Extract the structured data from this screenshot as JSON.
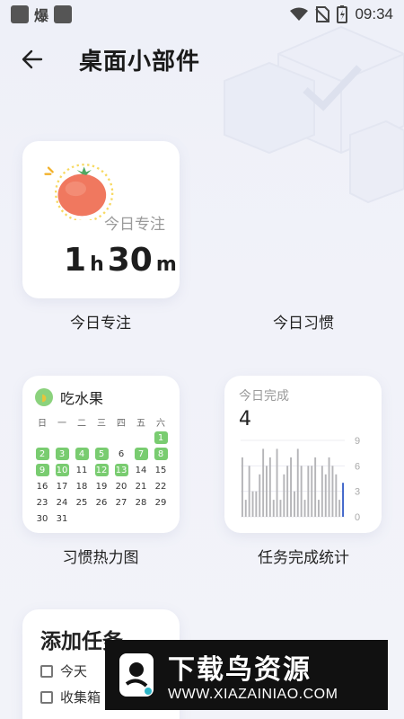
{
  "status_bar": {
    "time": "09:34",
    "app_icon_text": "爆"
  },
  "header": {
    "title": "桌面小部件"
  },
  "widgets": {
    "focus": {
      "label": "今日专注",
      "hours": "1",
      "hours_unit": "h",
      "minutes": "30",
      "minutes_unit": "m",
      "caption": "今日专注"
    },
    "habit": {
      "caption": "今日习惯"
    },
    "heatmap": {
      "habit_name": "吃水果",
      "caption": "习惯热力图",
      "weekdays": [
        "日",
        "一",
        "二",
        "三",
        "四",
        "五",
        "六"
      ],
      "leading_blanks": 6,
      "days_in_month": 31,
      "completed_days": [
        1,
        2,
        3,
        4,
        5,
        7,
        8,
        9,
        10,
        12,
        13
      ]
    },
    "tasks": {
      "label": "今日完成",
      "value": "4",
      "caption": "任务完成统计",
      "axis_ticks": [
        "9",
        "6",
        "3",
        "0"
      ]
    },
    "add_task": {
      "title": "添加任务",
      "items": [
        "今天",
        "收集箱"
      ]
    }
  },
  "chart_data": {
    "type": "bar",
    "ylim": [
      0,
      9
    ],
    "y_ticks": [
      0,
      3,
      6,
      9
    ],
    "values": [
      7,
      2,
      6,
      3,
      3,
      5,
      8,
      6,
      7,
      2,
      8,
      2,
      5,
      6,
      7,
      3,
      8,
      6,
      2,
      6,
      6,
      7,
      2,
      6,
      5,
      7,
      6,
      5,
      2,
      4
    ],
    "highlight_last": true
  },
  "watermark": {
    "brand": "下载鸟资源",
    "url": "WWW.XIAZAINIAO.COM"
  }
}
